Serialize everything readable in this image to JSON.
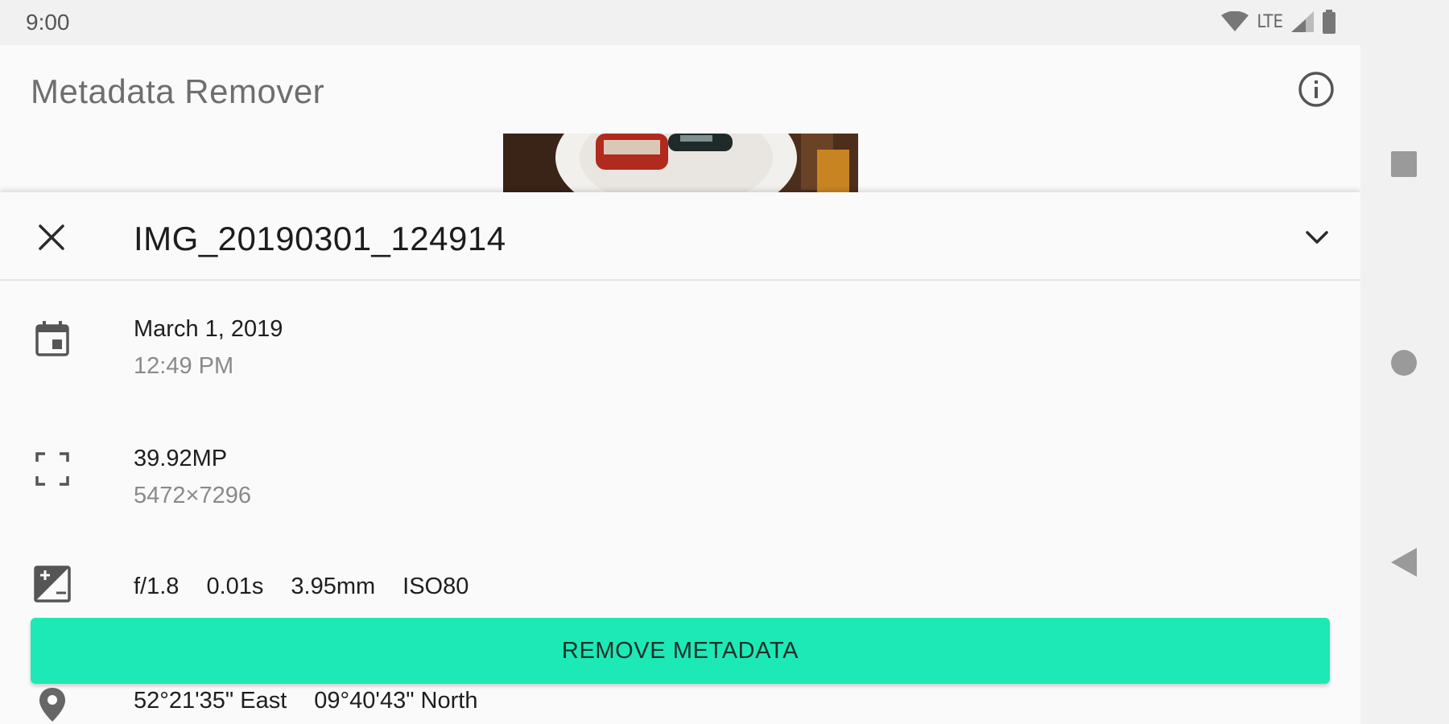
{
  "status_bar": {
    "time": "9:00",
    "network": "LTE"
  },
  "app_bar": {
    "title": "Metadata Remover",
    "info_icon": "info-icon"
  },
  "sheet": {
    "file_name": "IMG_20190301_124914",
    "close_icon": "close-icon",
    "expand_icon": "chevron-down-icon",
    "date": {
      "primary": "March 1, 2019",
      "secondary": "12:49 PM",
      "icon": "calendar-icon"
    },
    "resolution": {
      "primary": "39.92MP",
      "secondary": "5472×7296",
      "icon": "fullscreen-icon"
    },
    "exposure": {
      "aperture": "f/1.8",
      "shutter": "0.01s",
      "focal_length": "3.95mm",
      "iso": "ISO80",
      "icon": "exposure-icon"
    },
    "location": {
      "east": "52°21'35\" East",
      "north": "09°40'43\" North",
      "icon": "location-pin-icon"
    }
  },
  "actions": {
    "remove_label": "REMOVE METADATA"
  },
  "colors": {
    "accent": "#1de9b6",
    "background": "#fafafa",
    "status_bar": "#f1f1f1"
  },
  "nav_bar": {
    "recents_icon": "square-icon",
    "home_icon": "circle-icon",
    "back_icon": "triangle-back-icon"
  }
}
